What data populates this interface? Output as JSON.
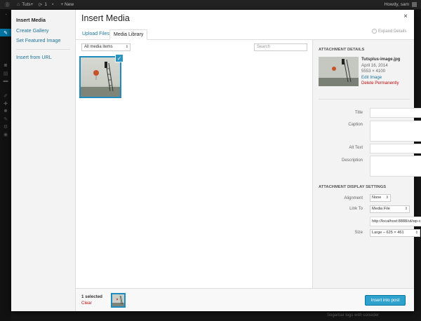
{
  "adminbar": {
    "site_name": "Tuts+",
    "updates_count": "1",
    "new_label": "+ New",
    "howdy": "Howdy, sam"
  },
  "background": {
    "footer_text": "Sogarbar logs with consider"
  },
  "modal": {
    "title": "Insert Media",
    "close_glyph": "×",
    "menu": {
      "insert_media": "Insert Media",
      "create_gallery": "Create Gallery",
      "set_featured_image": "Set Featured Image",
      "insert_from_url": "Insert from URL"
    },
    "tabs": {
      "upload": "Upload Files",
      "library": "Media Library"
    },
    "expand_details": "Expand Details",
    "filter": {
      "selected": "All media items"
    },
    "search": {
      "placeholder": "Search"
    }
  },
  "attachment": {
    "heading": "Attachment Details",
    "filename": "Tutsplus-image.jpg",
    "date": "April 16, 2014",
    "dimensions": "5553 × 4100",
    "edit_link": "Edit Image",
    "delete_link": "Delete Permanently",
    "labels": {
      "title": "Title",
      "caption": "Caption",
      "alt": "Alt Text",
      "description": "Description"
    },
    "values": {
      "title": "",
      "caption": "",
      "alt": "",
      "description": ""
    }
  },
  "display_settings": {
    "heading": "Attachment Display Settings",
    "alignment_label": "Alignment",
    "alignment_value": "None",
    "linkto_label": "Link To",
    "linkto_value": "Media File",
    "link_url": "http://localhost:8888/ut/wp-c",
    "size_label": "Size",
    "size_value": "Large – 625 × 461"
  },
  "toolbar": {
    "selected": "1 selected",
    "clear": "Clear",
    "insert_button": "Insert into post"
  },
  "colors": {
    "accent": "#2ea2cc",
    "link": "#21759b",
    "danger": "#bc0b0b",
    "admin_active": "#0074a2"
  }
}
